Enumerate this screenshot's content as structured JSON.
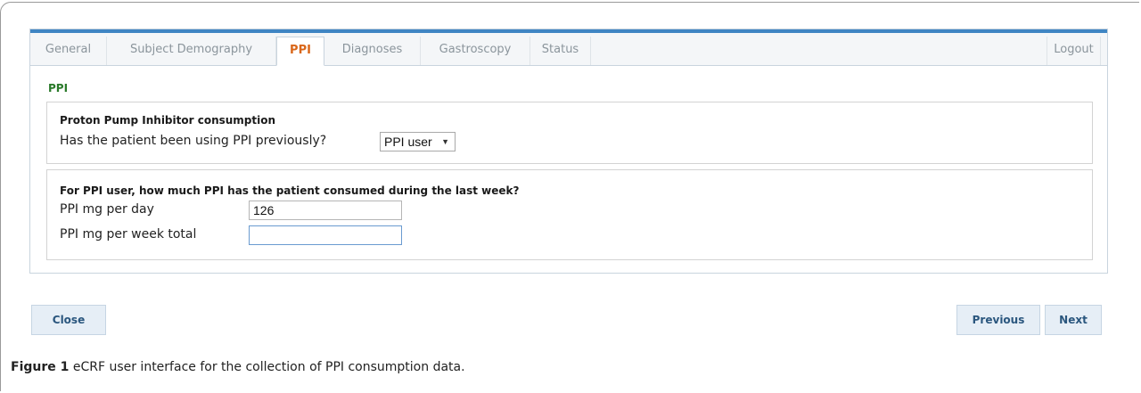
{
  "tabs": [
    {
      "label": "General"
    },
    {
      "label": "Subject Demography"
    },
    {
      "label": "PPI",
      "active": true
    },
    {
      "label": "Diagnoses"
    },
    {
      "label": "Gastroscopy"
    },
    {
      "label": "Status"
    }
  ],
  "logout_label": "Logout",
  "section_title": "PPI",
  "consumption": {
    "heading": "Proton Pump Inhibitor consumption",
    "question": "Has the patient been using PPI previously?",
    "selected": "PPI user"
  },
  "amount": {
    "heading": "For PPI user, how much PPI has the patient consumed during the last week?",
    "per_day_label": "PPI mg per day",
    "per_day_value": "126",
    "per_week_label": "PPI mg per week total",
    "per_week_value": ""
  },
  "buttons": {
    "close": "Close",
    "previous": "Previous",
    "next": "Next"
  },
  "caption": {
    "label": "Figure 1",
    "text": "eCRF user interface for the collection of PPI consumption data."
  },
  "colors": {
    "accent": "#3f85c3",
    "active_tab": "#d9671a",
    "section_title": "#2a7a2a"
  }
}
